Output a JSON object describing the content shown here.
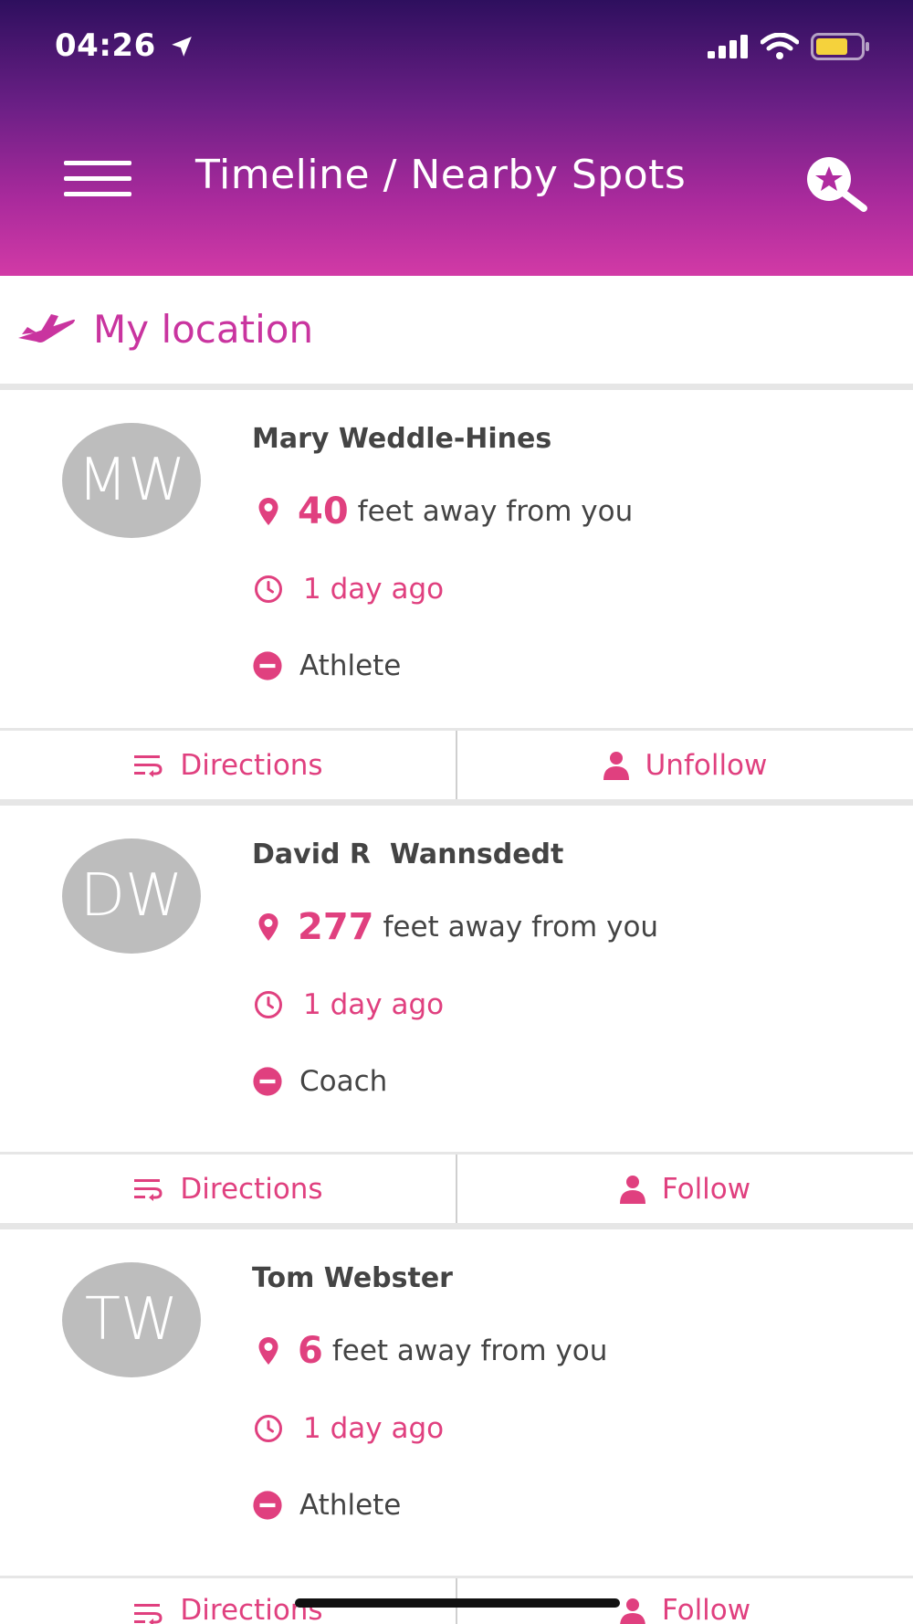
{
  "status_bar": {
    "time": "04:26",
    "icons": [
      "location-arrow-icon",
      "cellular-signal-icon",
      "wifi-icon",
      "battery-icon"
    ]
  },
  "header": {
    "title": "Timeline / Nearby Spots",
    "menu_icon": "hamburger-menu-icon",
    "search_icon": "star-search-icon"
  },
  "location": {
    "label": "My location",
    "icon": "airplane-icon"
  },
  "colors": {
    "accent": "#e0407f",
    "brand_purple": "#c9349f",
    "avatar_bg": "#bdbdbd",
    "header_top": "#2e0f5e",
    "header_bottom": "#d23aa6"
  },
  "people": [
    {
      "initials": "MW",
      "name": "Mary Weddle-Hines",
      "distance": "40",
      "distance_suffix": "feet away from you",
      "time": "1 day ago",
      "role": "Athlete",
      "directions_label": "Directions",
      "follow_label": "Unfollow"
    },
    {
      "initials": "DW",
      "name": "David R  Wannsdedt",
      "distance": "277",
      "distance_suffix": "feet away from you",
      "time": "1 day ago",
      "role": "Coach",
      "directions_label": "Directions",
      "follow_label": "Follow"
    },
    {
      "initials": "TW",
      "name": "Tom Webster",
      "distance": "6",
      "distance_suffix": "feet away from you",
      "time": "1 day ago",
      "role": "Athlete",
      "directions_label": "Directions",
      "follow_label": "Follow"
    }
  ]
}
